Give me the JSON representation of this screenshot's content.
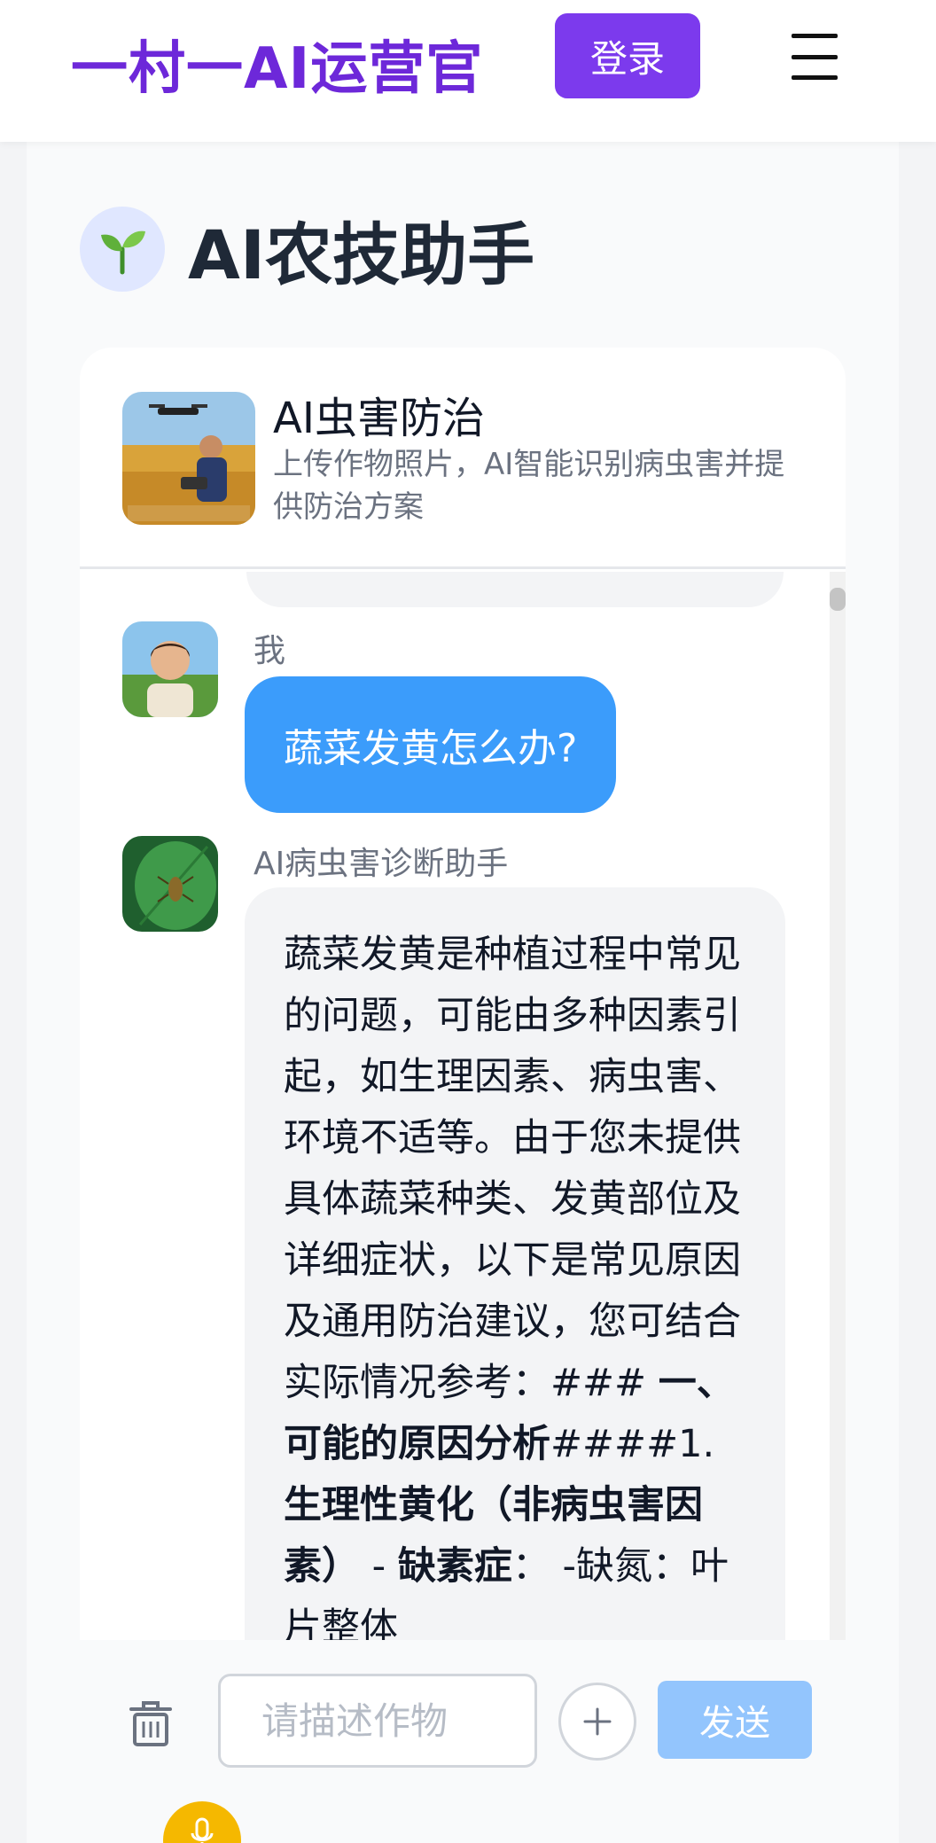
{
  "header": {
    "brand": "一村一AI运营官",
    "login_label": "登录",
    "menu_icon": "hamburger-menu-icon"
  },
  "page": {
    "title": "AI农技助手",
    "title_icon": "sprout-icon"
  },
  "chat": {
    "tool_title": "AI虫害防治",
    "tool_desc": "上传作物照片，AI智能识别病虫害并提供防治方案",
    "messages": [
      {
        "sender": "我",
        "text": "蔬菜发黄怎么办?"
      },
      {
        "sender": "AI病虫害诊断助手",
        "text_plain": "蔬菜发黄是种植过程中常见的问题，可能由多种因素引起，如生理因素、病虫害、环境不适等。由于您未提供具体蔬菜种类、发黄部位及详细症状，以下是常见原因及通用防治建议，您可结合实际情况参考：### ",
        "text_bold_1": "一、可能的原因分析",
        "text_mid": "####1. ",
        "text_bold_2": "生理性黄化（非病虫害因素）",
        "text_mid2": " - ",
        "text_bold_3": "缺素症",
        "text_tail": "： -缺氮：叶片整体"
      }
    ]
  },
  "input_bar": {
    "placeholder": "请描述作物",
    "send_label": "发送",
    "icons": [
      "trash-icon",
      "plus-icon",
      "microphone-icon"
    ]
  },
  "colors": {
    "brand": "#6d28d9",
    "login": "#7c3aed",
    "user_bubble": "#3b9cfb",
    "send_disabled": "#93c5fd",
    "mic": "#f5b800"
  }
}
